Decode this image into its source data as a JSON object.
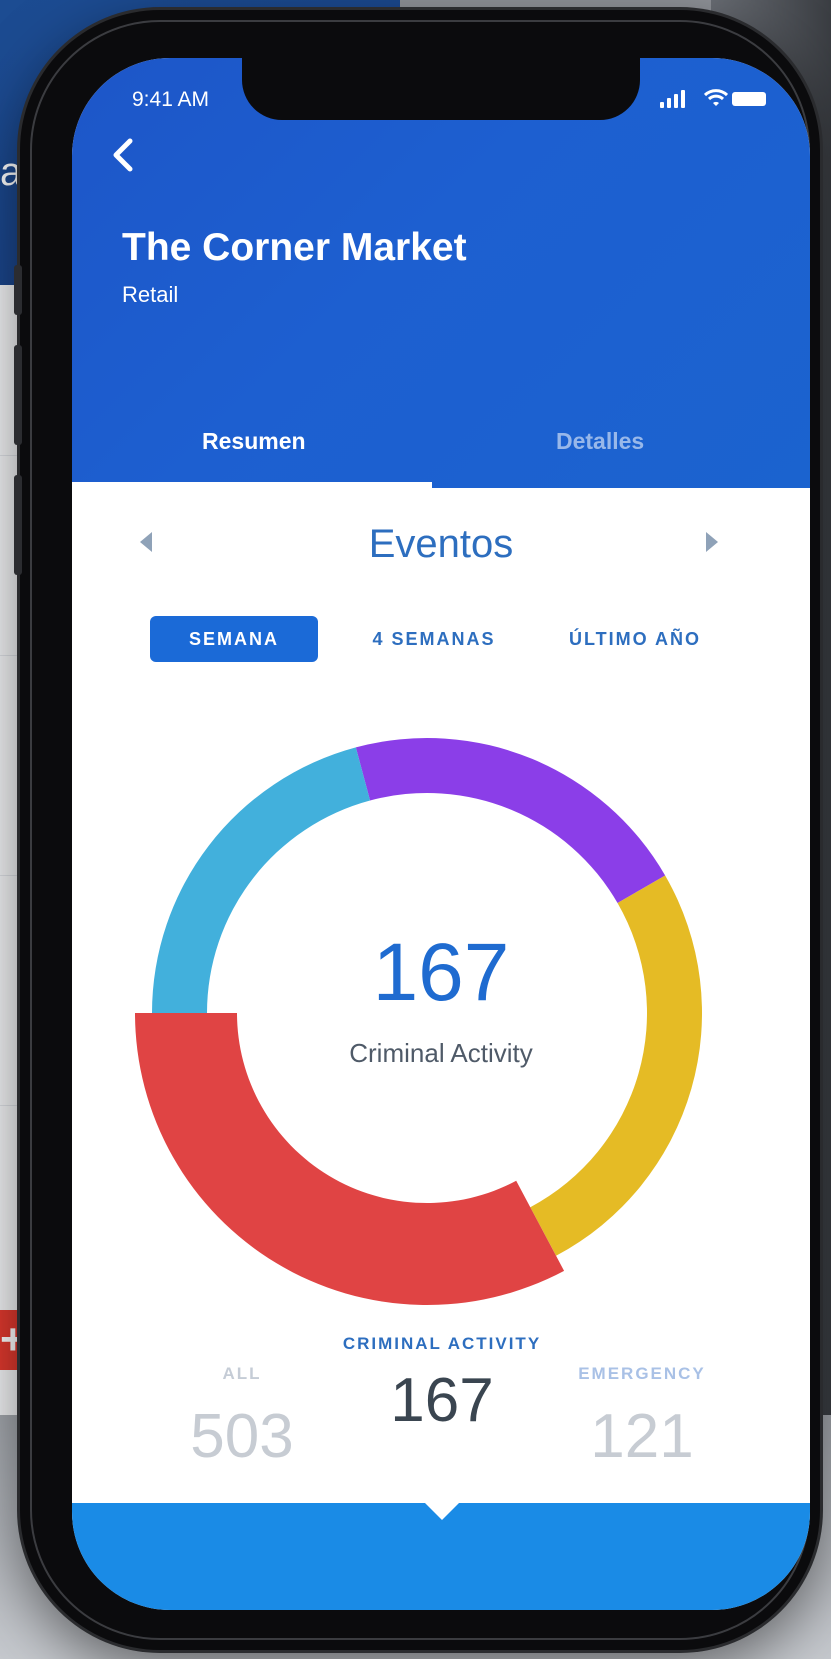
{
  "background_app": {
    "header_letter": "a"
  },
  "status_bar": {
    "time": "9:41 AM"
  },
  "header": {
    "title": "The Corner Market",
    "subtitle": "Retail"
  },
  "tabs": [
    {
      "label": "Resumen",
      "active": true
    },
    {
      "label": "Detalles",
      "active": false
    }
  ],
  "section": {
    "title": "Eventos"
  },
  "segments": [
    {
      "label": "SEMANA",
      "active": true
    },
    {
      "label": "4 SEMANAS",
      "active": false
    },
    {
      "label": "ÚLTIMO AÑO",
      "active": false
    }
  ],
  "donut": {
    "center_value": "167",
    "center_label": "Criminal Activity",
    "segments": [
      {
        "color": "#8b3ee8",
        "highlighted": false
      },
      {
        "color": "#e5bb25",
        "highlighted": false
      },
      {
        "color": "#e04444",
        "highlighted": true
      },
      {
        "color": "#42b0dc",
        "highlighted": false
      }
    ]
  },
  "stats": [
    {
      "label": "ALL",
      "value": "503"
    },
    {
      "label": "CRIMINAL ACTIVITY",
      "value": "167"
    },
    {
      "label": "EMERGENCY",
      "value": "121"
    }
  ],
  "colors": {
    "brand_blue": "#1d5fd0",
    "accent_blue": "#2d6ebf",
    "bottom_bar": "#1a8be6"
  }
}
